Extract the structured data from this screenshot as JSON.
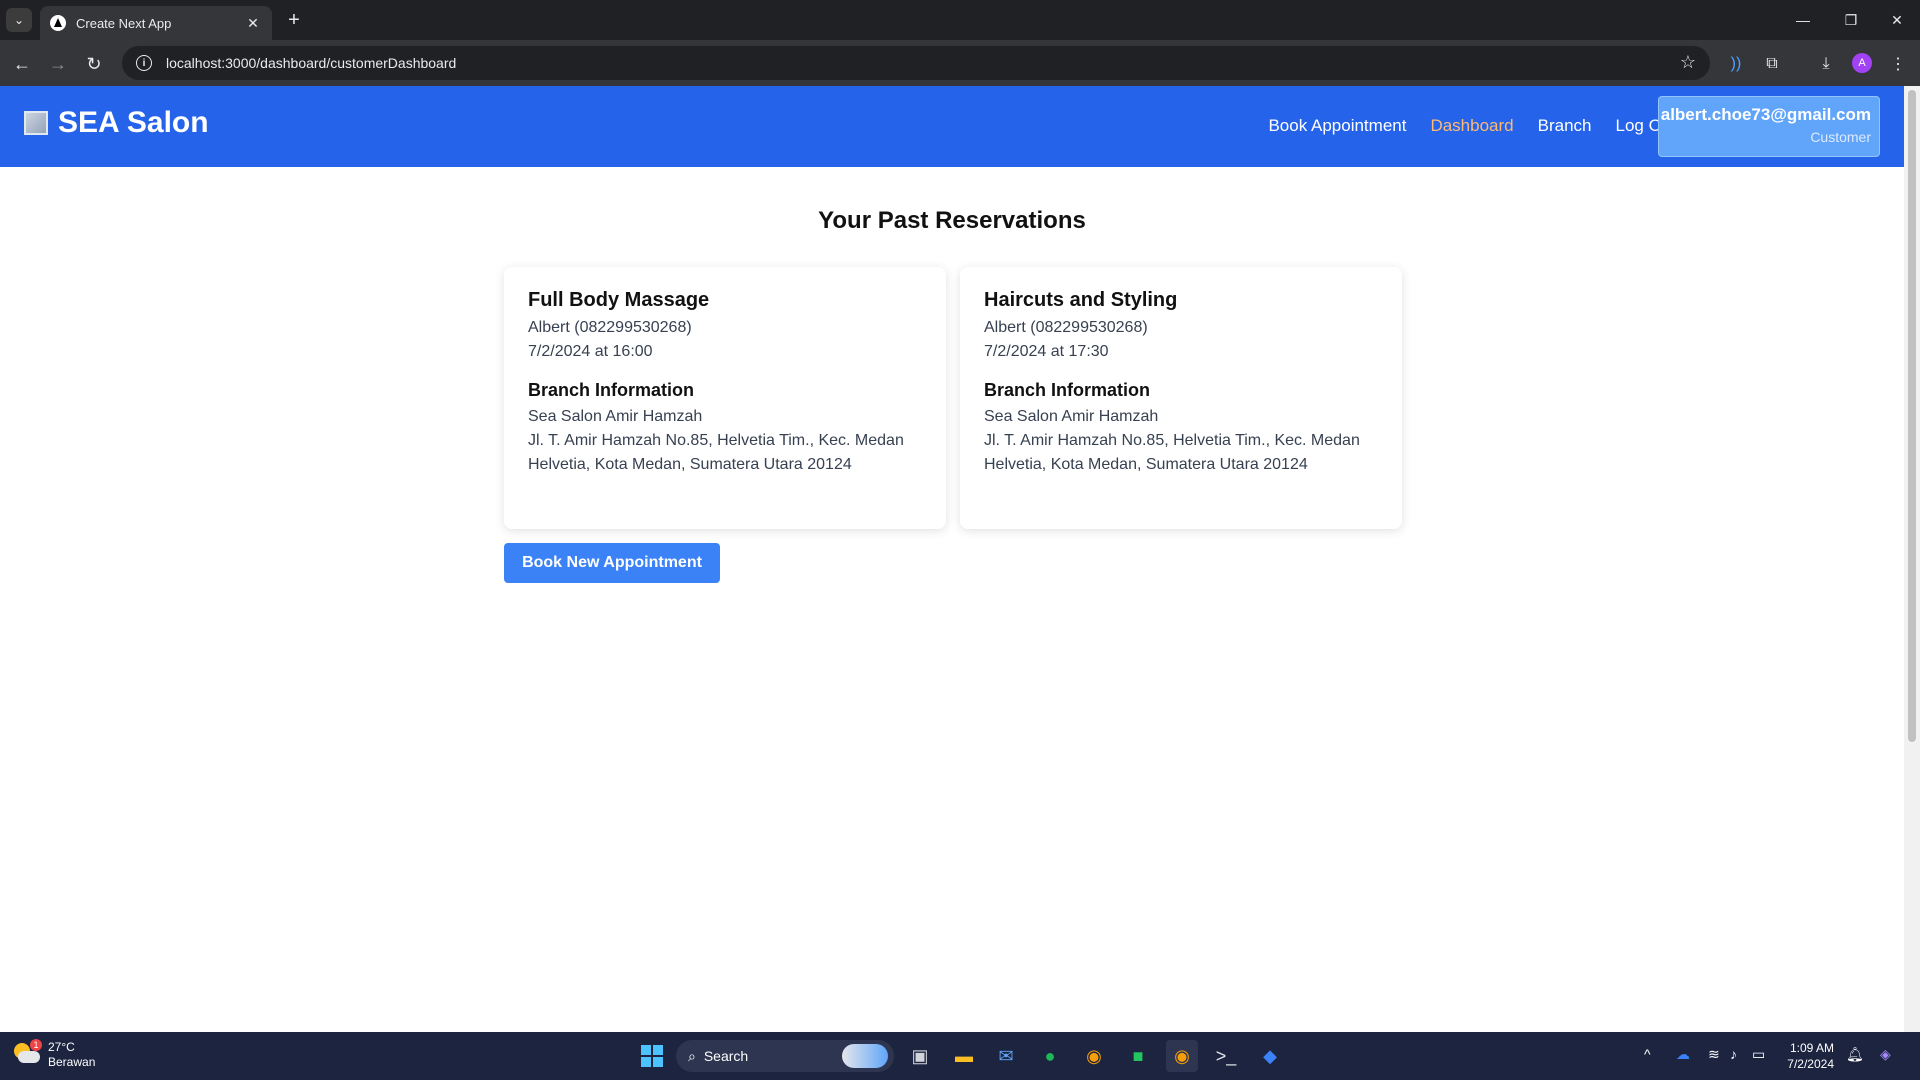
{
  "browser": {
    "tab_title": "Create Next App",
    "url": "localhost:3000/dashboard/customerDashboard",
    "profile_initial": "A"
  },
  "header": {
    "brand": "SEA Salon",
    "nav": [
      "Book Appointment",
      "Dashboard",
      "Branch",
      "Log Out"
    ],
    "active_nav": "Dashboard",
    "user_email": "albert.choe73@gmail.com",
    "user_role": "Customer"
  },
  "main": {
    "title": "Your Past Reservations",
    "reservations": [
      {
        "service": "Full Body Massage",
        "customer": "Albert (082299530268)",
        "datetime": "7/2/2024 at 16:00",
        "branch_heading": "Branch Information",
        "branch_name": "Sea Salon Amir Hamzah",
        "branch_address": "Jl. T. Amir Hamzah No.85, Helvetia Tim., Kec. Medan Helvetia, Kota Medan, Sumatera Utara 20124"
      },
      {
        "service": "Haircuts and Styling",
        "customer": "Albert (082299530268)",
        "datetime": "7/2/2024 at 17:30",
        "branch_heading": "Branch Information",
        "branch_name": "Sea Salon Amir Hamzah",
        "branch_address": "Jl. T. Amir Hamzah No.85, Helvetia Tim., Kec. Medan Helvetia, Kota Medan, Sumatera Utara 20124"
      }
    ],
    "book_button": "Book New Appointment"
  },
  "taskbar": {
    "weather_temp": "27°C",
    "weather_desc": "Berawan",
    "weather_badge": "1",
    "search_placeholder": "Search",
    "time": "1:09 AM",
    "date": "7/2/2024"
  },
  "colors": {
    "header": "#2563eb",
    "active_nav": "#fdba74",
    "button": "#3b82f6"
  }
}
